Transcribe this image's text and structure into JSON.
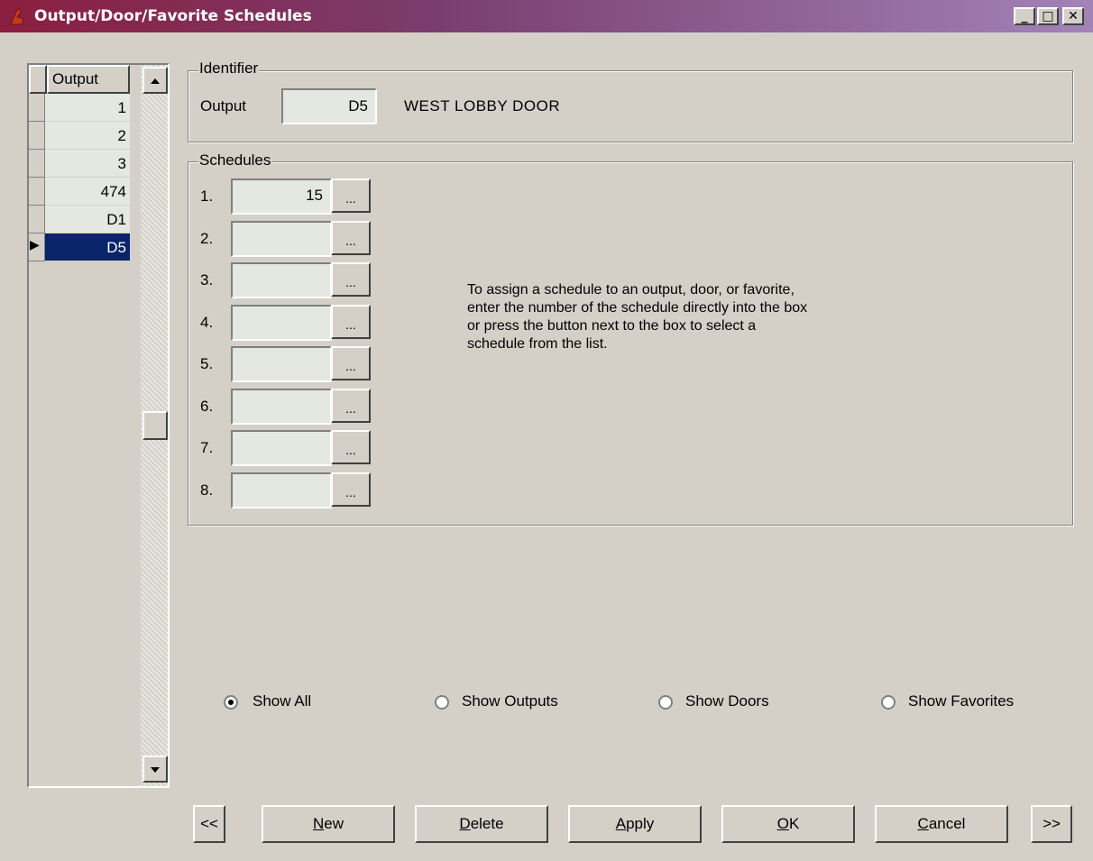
{
  "window": {
    "title": "Output/Door/Favorite Schedules",
    "minimize": "_",
    "maximize": "□",
    "close": "✕"
  },
  "grid": {
    "header": "Output",
    "rows": [
      "1",
      "2",
      "3",
      "474",
      "D1",
      "D5"
    ],
    "selected_row": "D5",
    "row_pointer": "▶"
  },
  "identifier": {
    "legend": "Identifier",
    "label": "Output",
    "value": "D5",
    "description": "WEST LOBBY DOOR"
  },
  "schedules": {
    "legend": "Schedules",
    "rows": [
      {
        "num": "1.",
        "value": "15"
      },
      {
        "num": "2.",
        "value": ""
      },
      {
        "num": "3.",
        "value": ""
      },
      {
        "num": "4.",
        "value": ""
      },
      {
        "num": "5.",
        "value": ""
      },
      {
        "num": "6.",
        "value": ""
      },
      {
        "num": "7.",
        "value": ""
      },
      {
        "num": "8.",
        "value": ""
      }
    ],
    "button_label": "...",
    "help_text": "To assign a schedule to an output, door, or favorite, enter the number of the schedule directly into the box or press the button next to the box to select a schedule from the list."
  },
  "filters": {
    "selected": "Show All",
    "options": [
      "Show All",
      "Show Outputs",
      "Show Doors",
      "Show Favorites"
    ]
  },
  "buttons": {
    "prev": "<<",
    "new": "New",
    "delete": "Delete",
    "apply": "Apply",
    "ok": "OK",
    "cancel": "Cancel",
    "next": ">>"
  },
  "colors": {
    "titlebar_start": "#8b1e3f",
    "titlebar_end": "#a283b8",
    "face": "#d4d0c8",
    "field": "#e4e8e0",
    "selection": "#0a246a"
  }
}
